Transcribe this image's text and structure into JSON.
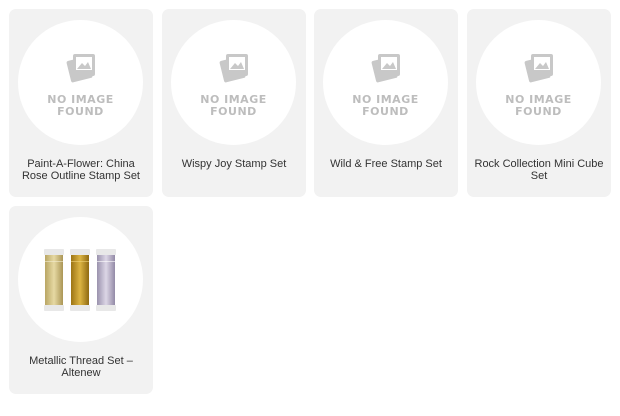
{
  "placeholder": {
    "line1": "NO IMAGE",
    "line2": "FOUND",
    "icon": "no-image-photo-icon"
  },
  "products": [
    {
      "title": "Paint-A-Flower: China Rose Outline Stamp Set",
      "image": "none"
    },
    {
      "title": "Wispy Joy Stamp Set",
      "image": "none"
    },
    {
      "title": "Wild & Free Stamp Set",
      "image": "none"
    },
    {
      "title": "Rock Collection Mini Cube Set",
      "image": "none"
    },
    {
      "title": "Metallic Thread Set – Altenew",
      "image": "thread-spools"
    }
  ],
  "colors": {
    "card_bg": "#f2f2f2",
    "placeholder_text": "#bdbdbd",
    "thread_light_gold": "#d8c78a",
    "thread_gold": "#c49a2a",
    "thread_silver": "#b8b0c8"
  }
}
